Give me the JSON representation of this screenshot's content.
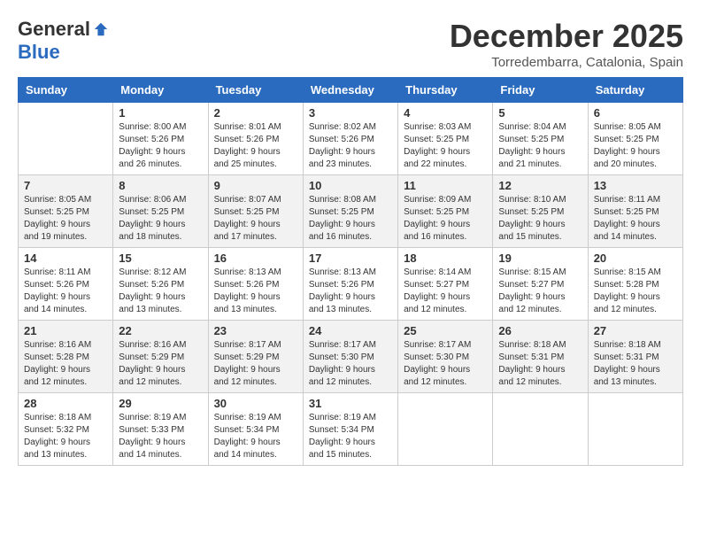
{
  "header": {
    "logo_general": "General",
    "logo_blue": "Blue",
    "month_title": "December 2025",
    "location": "Torredembarra, Catalonia, Spain"
  },
  "days_of_week": [
    "Sunday",
    "Monday",
    "Tuesday",
    "Wednesday",
    "Thursday",
    "Friday",
    "Saturday"
  ],
  "weeks": [
    [
      {
        "day": "",
        "detail": ""
      },
      {
        "day": "1",
        "detail": "Sunrise: 8:00 AM\nSunset: 5:26 PM\nDaylight: 9 hours\nand 26 minutes."
      },
      {
        "day": "2",
        "detail": "Sunrise: 8:01 AM\nSunset: 5:26 PM\nDaylight: 9 hours\nand 25 minutes."
      },
      {
        "day": "3",
        "detail": "Sunrise: 8:02 AM\nSunset: 5:26 PM\nDaylight: 9 hours\nand 23 minutes."
      },
      {
        "day": "4",
        "detail": "Sunrise: 8:03 AM\nSunset: 5:25 PM\nDaylight: 9 hours\nand 22 minutes."
      },
      {
        "day": "5",
        "detail": "Sunrise: 8:04 AM\nSunset: 5:25 PM\nDaylight: 9 hours\nand 21 minutes."
      },
      {
        "day": "6",
        "detail": "Sunrise: 8:05 AM\nSunset: 5:25 PM\nDaylight: 9 hours\nand 20 minutes."
      }
    ],
    [
      {
        "day": "7",
        "detail": "Sunrise: 8:05 AM\nSunset: 5:25 PM\nDaylight: 9 hours\nand 19 minutes."
      },
      {
        "day": "8",
        "detail": "Sunrise: 8:06 AM\nSunset: 5:25 PM\nDaylight: 9 hours\nand 18 minutes."
      },
      {
        "day": "9",
        "detail": "Sunrise: 8:07 AM\nSunset: 5:25 PM\nDaylight: 9 hours\nand 17 minutes."
      },
      {
        "day": "10",
        "detail": "Sunrise: 8:08 AM\nSunset: 5:25 PM\nDaylight: 9 hours\nand 16 minutes."
      },
      {
        "day": "11",
        "detail": "Sunrise: 8:09 AM\nSunset: 5:25 PM\nDaylight: 9 hours\nand 16 minutes."
      },
      {
        "day": "12",
        "detail": "Sunrise: 8:10 AM\nSunset: 5:25 PM\nDaylight: 9 hours\nand 15 minutes."
      },
      {
        "day": "13",
        "detail": "Sunrise: 8:11 AM\nSunset: 5:25 PM\nDaylight: 9 hours\nand 14 minutes."
      }
    ],
    [
      {
        "day": "14",
        "detail": "Sunrise: 8:11 AM\nSunset: 5:26 PM\nDaylight: 9 hours\nand 14 minutes."
      },
      {
        "day": "15",
        "detail": "Sunrise: 8:12 AM\nSunset: 5:26 PM\nDaylight: 9 hours\nand 13 minutes."
      },
      {
        "day": "16",
        "detail": "Sunrise: 8:13 AM\nSunset: 5:26 PM\nDaylight: 9 hours\nand 13 minutes."
      },
      {
        "day": "17",
        "detail": "Sunrise: 8:13 AM\nSunset: 5:26 PM\nDaylight: 9 hours\nand 13 minutes."
      },
      {
        "day": "18",
        "detail": "Sunrise: 8:14 AM\nSunset: 5:27 PM\nDaylight: 9 hours\nand 12 minutes."
      },
      {
        "day": "19",
        "detail": "Sunrise: 8:15 AM\nSunset: 5:27 PM\nDaylight: 9 hours\nand 12 minutes."
      },
      {
        "day": "20",
        "detail": "Sunrise: 8:15 AM\nSunset: 5:28 PM\nDaylight: 9 hours\nand 12 minutes."
      }
    ],
    [
      {
        "day": "21",
        "detail": "Sunrise: 8:16 AM\nSunset: 5:28 PM\nDaylight: 9 hours\nand 12 minutes."
      },
      {
        "day": "22",
        "detail": "Sunrise: 8:16 AM\nSunset: 5:29 PM\nDaylight: 9 hours\nand 12 minutes."
      },
      {
        "day": "23",
        "detail": "Sunrise: 8:17 AM\nSunset: 5:29 PM\nDaylight: 9 hours\nand 12 minutes."
      },
      {
        "day": "24",
        "detail": "Sunrise: 8:17 AM\nSunset: 5:30 PM\nDaylight: 9 hours\nand 12 minutes."
      },
      {
        "day": "25",
        "detail": "Sunrise: 8:17 AM\nSunset: 5:30 PM\nDaylight: 9 hours\nand 12 minutes."
      },
      {
        "day": "26",
        "detail": "Sunrise: 8:18 AM\nSunset: 5:31 PM\nDaylight: 9 hours\nand 12 minutes."
      },
      {
        "day": "27",
        "detail": "Sunrise: 8:18 AM\nSunset: 5:31 PM\nDaylight: 9 hours\nand 13 minutes."
      }
    ],
    [
      {
        "day": "28",
        "detail": "Sunrise: 8:18 AM\nSunset: 5:32 PM\nDaylight: 9 hours\nand 13 minutes."
      },
      {
        "day": "29",
        "detail": "Sunrise: 8:19 AM\nSunset: 5:33 PM\nDaylight: 9 hours\nand 14 minutes."
      },
      {
        "day": "30",
        "detail": "Sunrise: 8:19 AM\nSunset: 5:34 PM\nDaylight: 9 hours\nand 14 minutes."
      },
      {
        "day": "31",
        "detail": "Sunrise: 8:19 AM\nSunset: 5:34 PM\nDaylight: 9 hours\nand 15 minutes."
      },
      {
        "day": "",
        "detail": ""
      },
      {
        "day": "",
        "detail": ""
      },
      {
        "day": "",
        "detail": ""
      }
    ]
  ]
}
